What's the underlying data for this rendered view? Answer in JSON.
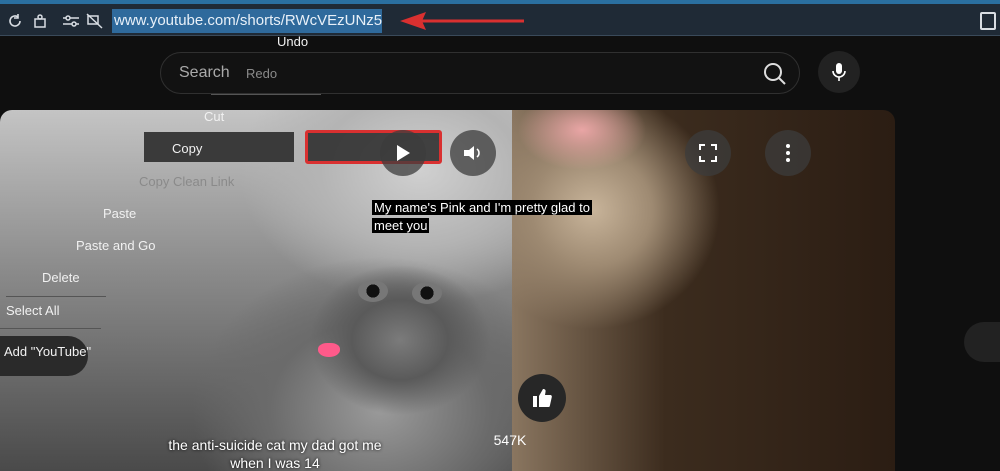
{
  "browser": {
    "url": "www.youtube.com/shorts/RWcVEzUNz5",
    "icons": [
      "reload-icon",
      "extension-icon",
      "site-settings-icon",
      "tracking-protection-icon",
      "tab-icon"
    ]
  },
  "header": {
    "search_placeholder": "Search",
    "search_icon": "search-icon",
    "mic_icon": "mic-icon"
  },
  "video": {
    "caption": [
      "My name's Pink and I'm pretty glad to",
      "meet you"
    ],
    "title": "the anti-suicide cat my dad got me when I was 14",
    "like_count": "547K",
    "controls": [
      "play-icon",
      "volume-icon",
      "fullscreen-icon",
      "more-icon"
    ]
  },
  "context_menu": {
    "items": [
      {
        "label": "Undo",
        "enabled": true
      },
      {
        "label": "Redo",
        "enabled": false
      },
      {
        "label": "Cut",
        "enabled": true
      },
      {
        "label": "Copy",
        "enabled": true,
        "highlighted": true
      },
      {
        "label": "Copy Clean Link",
        "enabled": false
      },
      {
        "label": "Paste",
        "enabled": true
      },
      {
        "label": "Paste and Go",
        "enabled": true
      },
      {
        "label": "Delete",
        "enabled": true
      },
      {
        "label": "Select All",
        "enabled": true
      },
      {
        "label": "Add \"YouTube\"",
        "enabled": true
      }
    ]
  },
  "colors": {
    "annotation": "#d93030",
    "url_highlight": "#2f6a9c",
    "page_bg": "#0f0f0f"
  }
}
